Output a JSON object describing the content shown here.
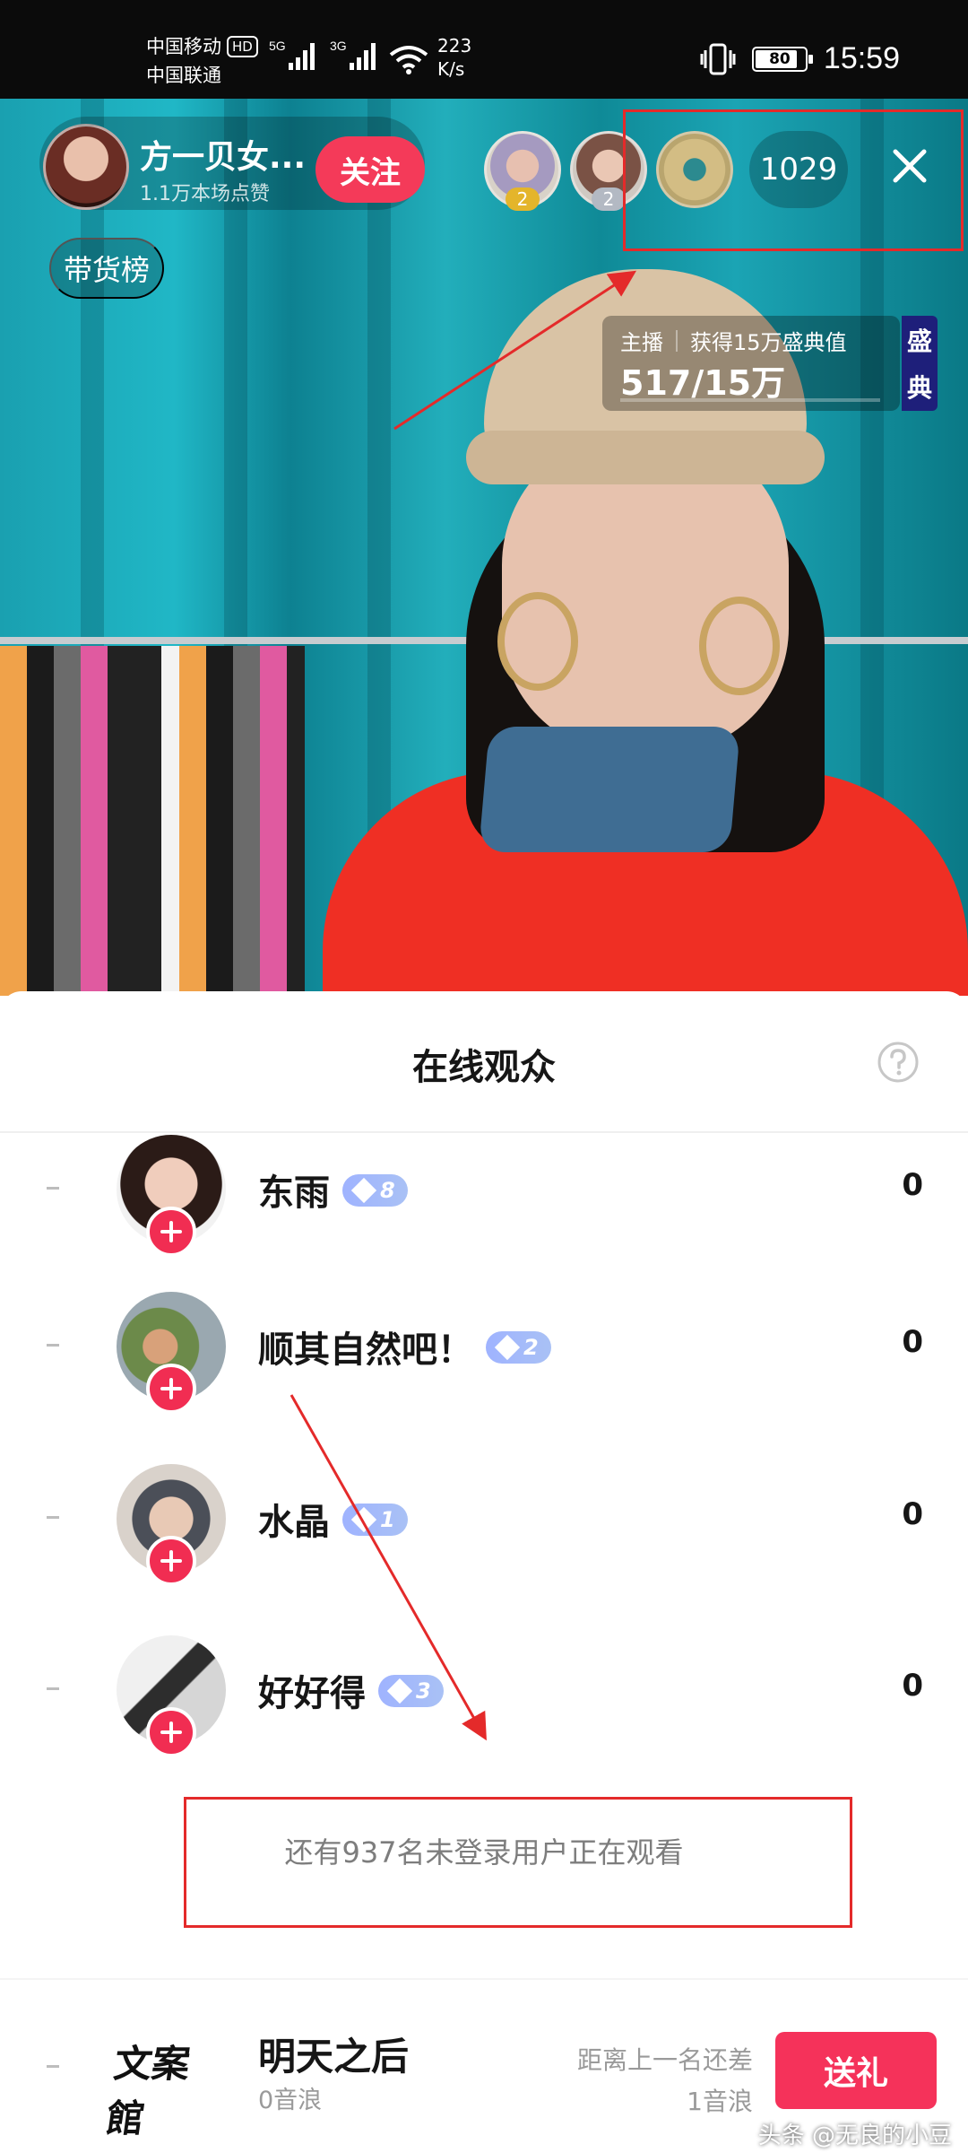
{
  "status_bar": {
    "carrier1": "中国移动",
    "hd_badge": "HD",
    "net5g": "5G",
    "net3g": "3G",
    "carrier2": "中国联通",
    "speed_value": "223",
    "speed_unit": "K/s",
    "battery": "80",
    "time": "15:59"
  },
  "host": {
    "name": "方一贝女...",
    "likes": "1.1万本场点赞",
    "follow_label": "关注"
  },
  "viewers_top": {
    "ranks": [
      "2",
      "2"
    ],
    "online_count": "1029"
  },
  "goods_rank_label": "带货榜",
  "event": {
    "host_label": "主播",
    "desc": "获得15万盛典值",
    "value": "517/15万",
    "tag": [
      "盛",
      "典"
    ]
  },
  "sheet": {
    "title": "在线观众",
    "rows": [
      {
        "rank": "-",
        "name": "东雨",
        "level": "8",
        "score": "0"
      },
      {
        "rank": "-",
        "name": "顺其自然吧！",
        "level": "2",
        "score": "0"
      },
      {
        "rank": "-",
        "name": "水晶",
        "level": "1",
        "score": "0"
      },
      {
        "rank": "-",
        "name": "好好得",
        "level": "3",
        "score": "0"
      }
    ],
    "unlogged_text": "还有937名未登录用户正在观看"
  },
  "me": {
    "rank": "-",
    "logo_text": "文案館",
    "name": "明天之后",
    "sub": "0音浪",
    "gap_line1": "距离上一名还差",
    "gap_line2": "1音浪",
    "gift_label": "送礼"
  },
  "watermark": "头条 @无良的小豆",
  "colors": {
    "accent": "#f43a59",
    "annotation_red": "#e42a2a",
    "event_tag": "#1e1f7a"
  }
}
